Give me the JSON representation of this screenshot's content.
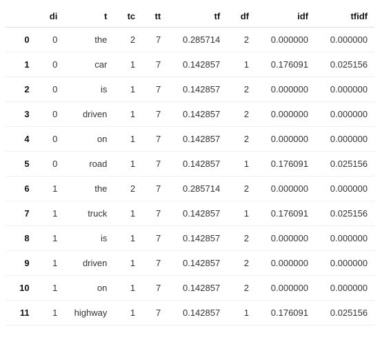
{
  "chart_data": {
    "type": "table",
    "columns": [
      "di",
      "t",
      "tc",
      "tt",
      "tf",
      "df",
      "idf",
      "tfidf"
    ],
    "index": [
      "0",
      "1",
      "2",
      "3",
      "4",
      "5",
      "6",
      "7",
      "8",
      "9",
      "10",
      "11"
    ],
    "rows": [
      {
        "di": 0,
        "t": "the",
        "tc": 2,
        "tt": 7,
        "tf": "0.285714",
        "df": 2,
        "idf": "0.000000",
        "tfidf": "0.000000"
      },
      {
        "di": 0,
        "t": "car",
        "tc": 1,
        "tt": 7,
        "tf": "0.142857",
        "df": 1,
        "idf": "0.176091",
        "tfidf": "0.025156"
      },
      {
        "di": 0,
        "t": "is",
        "tc": 1,
        "tt": 7,
        "tf": "0.142857",
        "df": 2,
        "idf": "0.000000",
        "tfidf": "0.000000"
      },
      {
        "di": 0,
        "t": "driven",
        "tc": 1,
        "tt": 7,
        "tf": "0.142857",
        "df": 2,
        "idf": "0.000000",
        "tfidf": "0.000000"
      },
      {
        "di": 0,
        "t": "on",
        "tc": 1,
        "tt": 7,
        "tf": "0.142857",
        "df": 2,
        "idf": "0.000000",
        "tfidf": "0.000000"
      },
      {
        "di": 0,
        "t": "road",
        "tc": 1,
        "tt": 7,
        "tf": "0.142857",
        "df": 1,
        "idf": "0.176091",
        "tfidf": "0.025156"
      },
      {
        "di": 1,
        "t": "the",
        "tc": 2,
        "tt": 7,
        "tf": "0.285714",
        "df": 2,
        "idf": "0.000000",
        "tfidf": "0.000000"
      },
      {
        "di": 1,
        "t": "truck",
        "tc": 1,
        "tt": 7,
        "tf": "0.142857",
        "df": 1,
        "idf": "0.176091",
        "tfidf": "0.025156"
      },
      {
        "di": 1,
        "t": "is",
        "tc": 1,
        "tt": 7,
        "tf": "0.142857",
        "df": 2,
        "idf": "0.000000",
        "tfidf": "0.000000"
      },
      {
        "di": 1,
        "t": "driven",
        "tc": 1,
        "tt": 7,
        "tf": "0.142857",
        "df": 2,
        "idf": "0.000000",
        "tfidf": "0.000000"
      },
      {
        "di": 1,
        "t": "on",
        "tc": 1,
        "tt": 7,
        "tf": "0.142857",
        "df": 2,
        "idf": "0.000000",
        "tfidf": "0.000000"
      },
      {
        "di": 1,
        "t": "highway",
        "tc": 1,
        "tt": 7,
        "tf": "0.142857",
        "df": 1,
        "idf": "0.176091",
        "tfidf": "0.025156"
      }
    ]
  }
}
